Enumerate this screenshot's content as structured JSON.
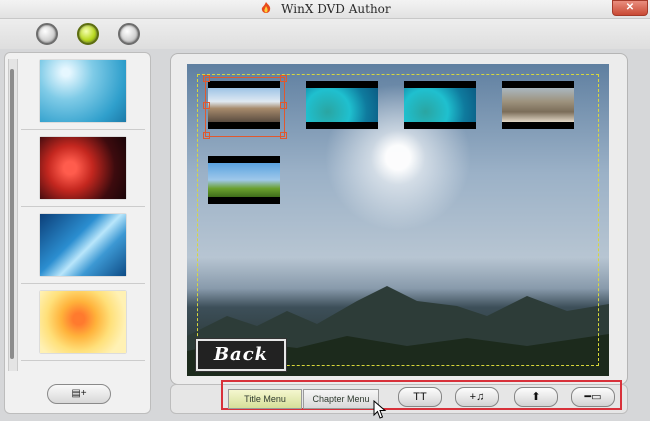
{
  "window": {
    "title": "WinX DVD Author",
    "close_glyph": "✕"
  },
  "toolbar": {
    "buttons": [
      "circle-button-1",
      "circle-button-2-active",
      "circle-button-3"
    ]
  },
  "sidebar": {
    "thumbnails": [
      "blue-water-background",
      "red-flowers-background",
      "blue-light-background",
      "orange-flowers-background"
    ],
    "add_button_glyph": "▤+"
  },
  "preview": {
    "back_label": "Back",
    "chapter_thumbnails": [
      "road-scene",
      "underwater-scene-1",
      "underwater-scene-2",
      "desert-scene",
      "birds-scene"
    ]
  },
  "bottom_bar": {
    "tab_title_menu": "Title Menu",
    "tab_chapter_menu": "Chapter Menu",
    "text_tool": "TT",
    "music_tool": "+♫",
    "up_tool": "⬆",
    "subtitle_tool": "━▭",
    "highlight_color": "#d8313a"
  }
}
